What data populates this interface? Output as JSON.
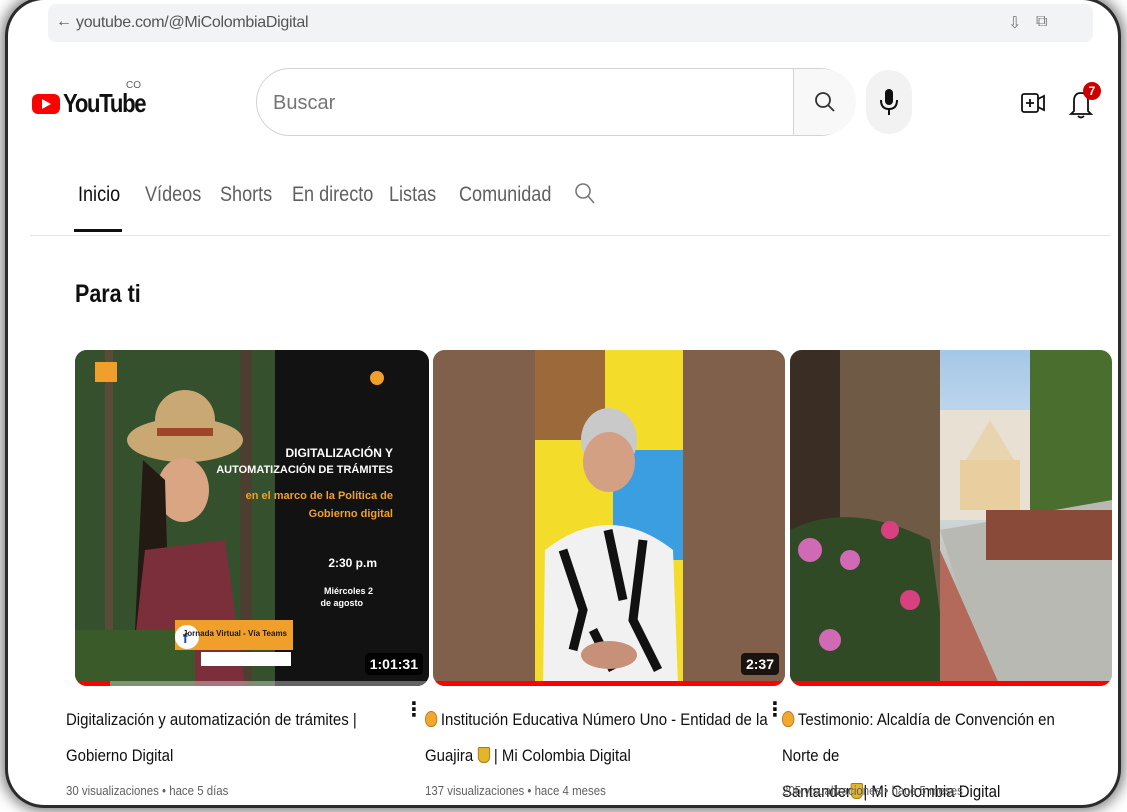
{
  "browser": {
    "url": "youtube.com/@MiColombiaDigital"
  },
  "header": {
    "logo_text": "YouTube",
    "country_code": "CO",
    "search_placeholder": "Buscar",
    "notification_count": "7"
  },
  "tabs": [
    {
      "label": "Inicio",
      "active": true
    },
    {
      "label": "Vídeos",
      "active": false
    },
    {
      "label": "Shorts",
      "active": false
    },
    {
      "label": "En directo",
      "active": false
    },
    {
      "label": "Listas",
      "active": false
    },
    {
      "label": "Comunidad",
      "active": false
    }
  ],
  "section": {
    "title": "Para ti"
  },
  "videos": [
    {
      "title_line1": "Digitalización y automatización de trámites |",
      "title_line2": "Gobierno Digital",
      "meta": "30 visualizaciones • hace 5 días",
      "duration": "1:01:31",
      "progress": 0.1,
      "thumb_text": {
        "heading1": "DIGITALIZACIÓN Y",
        "heading2": "AUTOMATIZACIÓN DE TRÁMITES",
        "sub1": "en el marco de la Política de",
        "sub2": "Gobierno digital",
        "time": "2:30 p.m",
        "date1": "Miércoles 2",
        "date2": "de agosto",
        "event": "Jornada Virtual - Vía Teams"
      }
    },
    {
      "title_line1": "Institución Educativa Número Uno - Entidad de la",
      "title_line2_a": "Guajira",
      "title_line2_b": "| Mi Colombia Digital",
      "meta": "137 visualizaciones • hace 4 meses",
      "duration": "2:37",
      "progress": 1.0
    },
    {
      "title_line1": "Testimonio: Alcaldía de Convención en Norte de",
      "title_line2_a": "Santander",
      "title_line2_b": "| Mi Colombia Digital",
      "meta": "205 visualizaciones • hace 5 meses",
      "progress": 1.0
    }
  ],
  "colors": {
    "brand_red": "#ff0000",
    "text_primary": "#0f0f0f",
    "text_secondary": "#606060"
  }
}
